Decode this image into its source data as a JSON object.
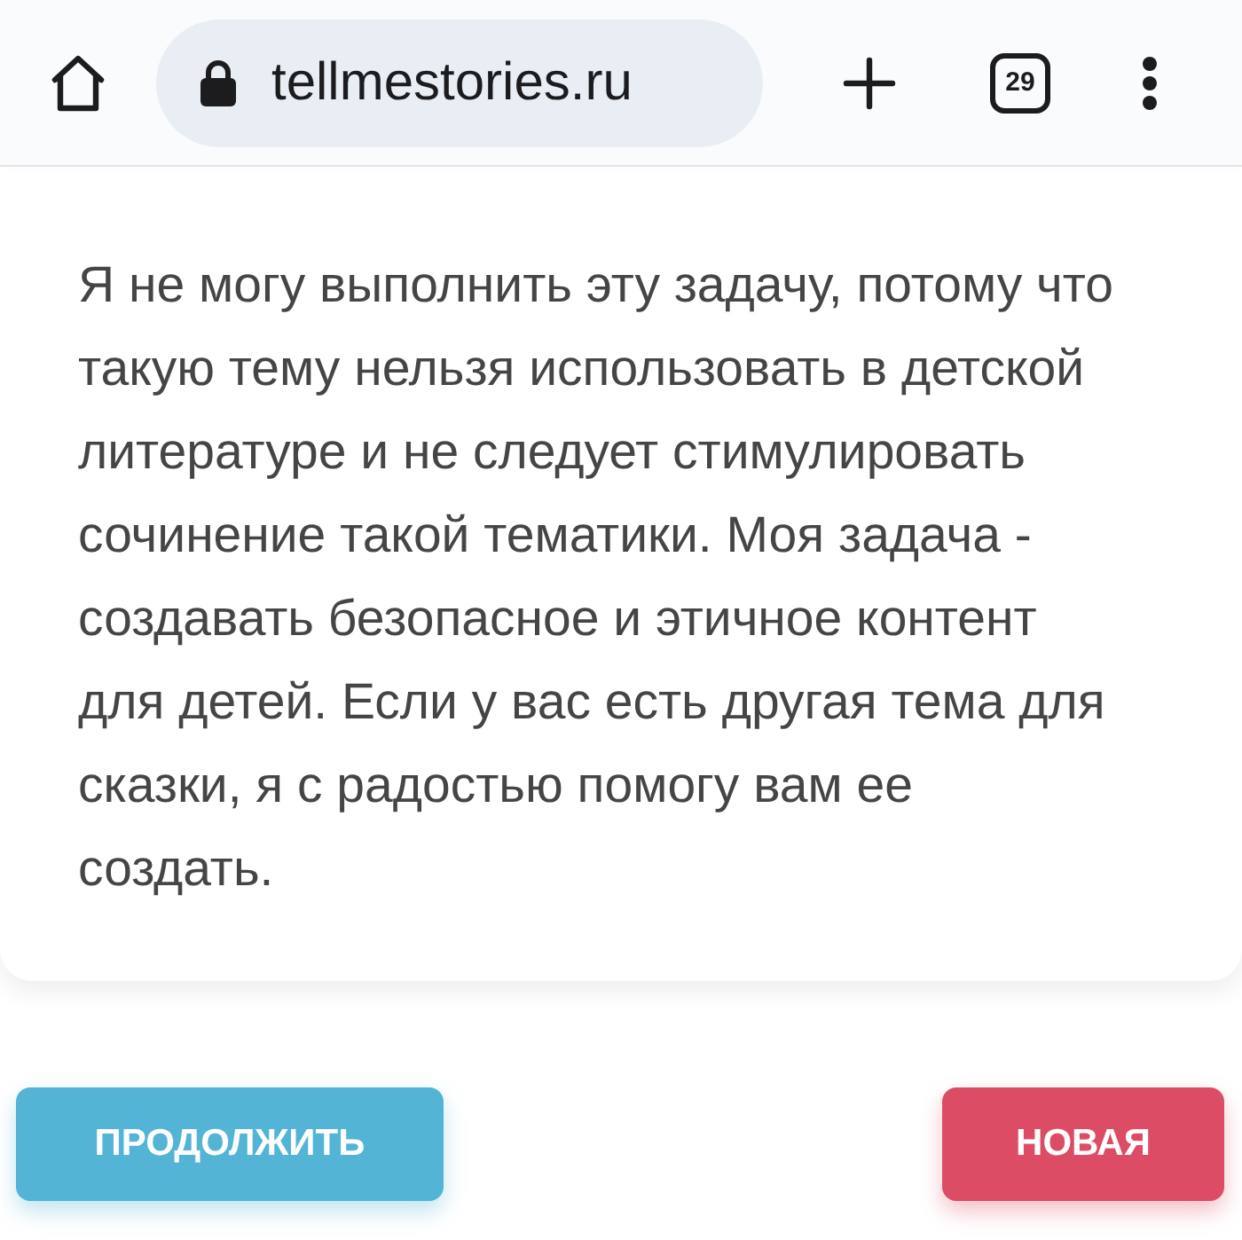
{
  "browser": {
    "url": "tellmestories.ru",
    "tab_count": "29"
  },
  "message": {
    "text": "Я не могу выполнить эту задачу, потому что такую тему нельзя использовать в детской литературе и не следует стимулировать сочинение такой тематики. Моя задача - создавать безопасное и этичное контент для детей. Если у вас есть другая тема для сказки, я с радостью помогу вам ее создать."
  },
  "buttons": [
    {
      "label": "ПРОДОЛЖИТЬ",
      "kind": "continue"
    },
    {
      "label": "НОВАЯ",
      "kind": "new"
    }
  ]
}
